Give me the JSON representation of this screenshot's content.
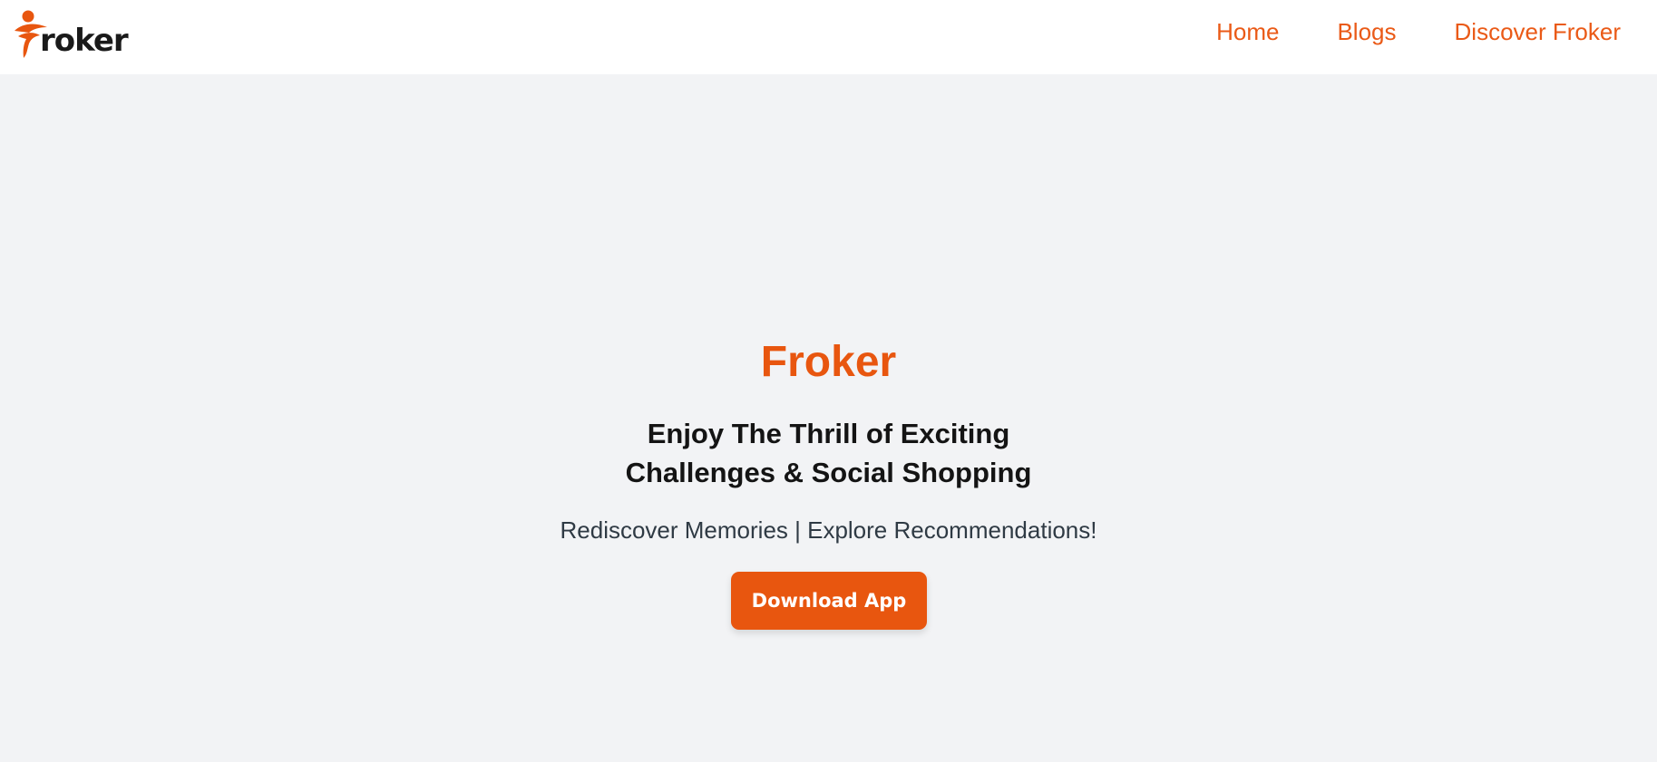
{
  "brand": {
    "logo_text": "roker",
    "logo_icon": "froker-runner-logo-icon"
  },
  "nav": {
    "items": [
      {
        "label": "Home"
      },
      {
        "label": "Blogs"
      },
      {
        "label": "Discover Froker"
      }
    ]
  },
  "hero": {
    "title": "Froker",
    "subtitle_line1": "Enjoy The Thrill of Exciting",
    "subtitle_line2": "Challenges & Social Shopping",
    "tagline": "Rediscover Memories | Explore Recommendations!",
    "cta_label": "Download App"
  },
  "colors": {
    "accent": "#e8560f",
    "nav_text": "#ea5a17",
    "background": "#f2f3f5",
    "header_background": "#ffffff"
  }
}
